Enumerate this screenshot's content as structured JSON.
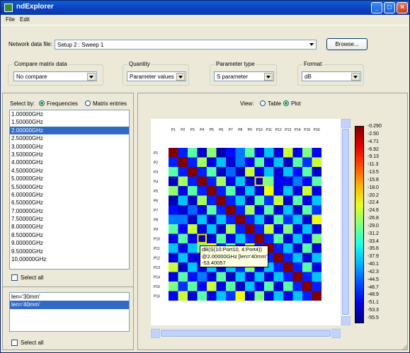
{
  "window": {
    "title": "ndExplorer"
  },
  "menu": [
    "File",
    "Edit"
  ],
  "network": {
    "label": "Network data file:",
    "value": "Setup 2 : Sweep 1",
    "browse_label": "Browse..."
  },
  "groups": {
    "compare": {
      "title": "Compare matrix data",
      "value": "No compare"
    },
    "quantity": {
      "title": "Quantity",
      "value": "Parameter values"
    },
    "ptype": {
      "title": "Parameter type",
      "value": "S parameter"
    },
    "format": {
      "title": "Format",
      "value": "dB"
    }
  },
  "select_by": {
    "label": "Select by:",
    "opt1": "Frequencies",
    "opt2": "Matrix entries",
    "selected": "Frequencies"
  },
  "frequencies": [
    "1.00000GHz",
    "1.50000GHz",
    "2.00000GHz",
    "2.50000GHz",
    "3.00000GHz",
    "3.50000GHz",
    "4.00000GHz",
    "4.50000GHz",
    "5.00000GHz",
    "5.50000GHz",
    "6.00000GHz",
    "6.50000GHz",
    "7.00000GHz",
    "7.50000GHz",
    "8.00000GHz",
    "8.50000GHz",
    "9.00000GHz",
    "9.50000GHz",
    "10.00000GHz"
  ],
  "selected_frequency": "2.00000GHz",
  "select_all_label": "Select all",
  "variations": [
    "len='30mm'",
    "len='40mm'"
  ],
  "selected_variation": "len='40mm'",
  "view": {
    "label": "View:",
    "opt1": "Table",
    "opt2": "Plot",
    "selected": "Plot"
  },
  "tooltip": {
    "line1": "dB(S(10:Port10, 4:Port4))",
    "line2": "@2.00000GHz [len='40mm']:",
    "line3": "-53.40057"
  },
  "colors": {
    "titlebar": "#0b3fba",
    "selection": "#316ac5",
    "highlight": "#f5e000"
  },
  "chart_data": {
    "type": "heatmap",
    "title": "",
    "x_labels": [
      "P1",
      "P2",
      "P3",
      "P4",
      "P5",
      "P6",
      "P7",
      "P8",
      "P9",
      "P10",
      "P11",
      "P12",
      "P13",
      "P14",
      "P15",
      "P16"
    ],
    "y_labels": [
      "P1",
      "P2",
      "P3",
      "P4",
      "P5",
      "P6",
      "P7",
      "P8",
      "P9",
      "P10",
      "P11",
      "P12",
      "P13",
      "P14",
      "P15",
      "P16"
    ],
    "colorbar_ticks": [
      "-0.290",
      "-2.50",
      "-4.71",
      "-6.92",
      "-9.13",
      "-11.3",
      "-13.5",
      "-15.8",
      "-18.0",
      "-20.2",
      "-22.4",
      "-24.6",
      "-26.8",
      "-29.0",
      "-31.2",
      "-33.4",
      "-35.6",
      "-37.9",
      "-40.1",
      "-42.3",
      "-44.5",
      "-46.7",
      "-48.9",
      "-51.1",
      "-53.3",
      "-55.5"
    ],
    "range": [
      -55.5,
      -0.29
    ],
    "highlighted_cells": [
      {
        "row": "P4",
        "col": "P10"
      },
      {
        "row": "P10",
        "col": "P4"
      }
    ],
    "values": [
      [
        -0.3,
        -47,
        -30,
        -52,
        -27,
        -53,
        -48,
        -42,
        -30,
        -50,
        -38,
        -51,
        -24,
        -50,
        -28,
        -49
      ],
      [
        -47,
        -0.3,
        -47,
        -26,
        -50,
        -38,
        -51,
        -42,
        -49,
        -30,
        -50,
        -38,
        -52,
        -30,
        -46,
        -24
      ],
      [
        -30,
        -47,
        -0.3,
        -47,
        -30,
        -52,
        -43,
        -52,
        -24,
        -50,
        -38,
        -51,
        -38,
        -48,
        -30,
        -51
      ],
      [
        -52,
        -26,
        -47,
        -0.3,
        -47,
        -26,
        -50,
        -38,
        -51,
        -53.4,
        -28,
        -49,
        -50,
        -42,
        -49,
        -30
      ],
      [
        -27,
        -50,
        -30,
        -47,
        -0.3,
        -47,
        -30,
        -51,
        -38,
        -51,
        -22,
        -50,
        -38,
        -51,
        -24,
        -50
      ],
      [
        -53,
        -38,
        -52,
        -26,
        -47,
        -0.3,
        -47,
        -38,
        -52,
        -30,
        -46,
        -24,
        -51,
        -30,
        -50,
        -38
      ],
      [
        -48,
        -51,
        -43,
        -50,
        -30,
        -47,
        -0.3,
        -47,
        -26,
        -50,
        -30,
        -51,
        -38,
        -52,
        -30,
        -46
      ],
      [
        -42,
        -42,
        -52,
        -38,
        -51,
        -38,
        -47,
        -0.3,
        -47,
        -38,
        -51,
        -30,
        -46,
        -38,
        -52,
        -22
      ],
      [
        -30,
        -49,
        -24,
        -51,
        -38,
        -52,
        -26,
        -47,
        -0.3,
        -47,
        -24,
        -50,
        -28,
        -50,
        -38,
        -51
      ],
      [
        -50,
        -30,
        -50,
        -53.4,
        -51,
        -30,
        -50,
        -38,
        -47,
        -0.3,
        -47,
        -30,
        -51,
        -38,
        -50,
        -28
      ],
      [
        -38,
        -50,
        -38,
        -28,
        -22,
        -46,
        -30,
        -51,
        -24,
        -47,
        -0.3,
        -47,
        -38,
        -51,
        -30,
        -51
      ],
      [
        -51,
        -38,
        -51,
        -49,
        -50,
        -24,
        -51,
        -30,
        -50,
        -30,
        -47,
        -0.3,
        -47,
        -38,
        -51,
        -38
      ],
      [
        -24,
        -52,
        -38,
        -50,
        -38,
        -51,
        -38,
        -46,
        -28,
        -51,
        -38,
        -47,
        -0.3,
        -47,
        -30,
        -50
      ],
      [
        -50,
        -30,
        -48,
        -42,
        -51,
        -30,
        -52,
        -38,
        -50,
        -38,
        -51,
        -38,
        -47,
        -0.3,
        -47,
        -38
      ],
      [
        -28,
        -46,
        -30,
        -49,
        -24,
        -50,
        -30,
        -52,
        -38,
        -50,
        -30,
        -51,
        -30,
        -47,
        -0.3,
        -47
      ],
      [
        -49,
        -24,
        -51,
        -30,
        -50,
        -38,
        -46,
        -22,
        -51,
        -28,
        -51,
        -38,
        -50,
        -38,
        -47,
        -0.3
      ]
    ]
  }
}
